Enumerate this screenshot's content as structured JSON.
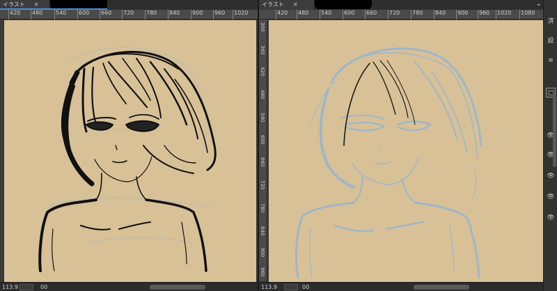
{
  "left_pane": {
    "tab_label": "イラスト",
    "tab_close": "×",
    "ruler_h": [
      "420",
      "480",
      "540",
      "600",
      "660",
      "720",
      "780",
      "840",
      "900",
      "960",
      "1020"
    ],
    "zoom": "113.9",
    "field_value": "00"
  },
  "right_pane": {
    "tab_label": "イラスト",
    "tab_close": "×",
    "ruler_h": [
      "420",
      "480",
      "540",
      "600",
      "660",
      "720",
      "780",
      "840",
      "900",
      "960",
      "1020",
      "1080"
    ],
    "ruler_v": [
      "300",
      "360",
      "420",
      "480",
      "540",
      "600",
      "660",
      "720",
      "780",
      "840",
      "900",
      "960"
    ],
    "zoom": "113.9",
    "field_value": "00",
    "chevron": "⌄",
    "side_items": [
      "済",
      "設",
      "□",
      "👁",
      "👁",
      "👁",
      "👁",
      "👁"
    ]
  },
  "colors": {
    "canvas": "#d8c197",
    "ink": "#111111",
    "sketch_blue": "#9ab5cf",
    "tab_accent": "#4e8fd4"
  }
}
